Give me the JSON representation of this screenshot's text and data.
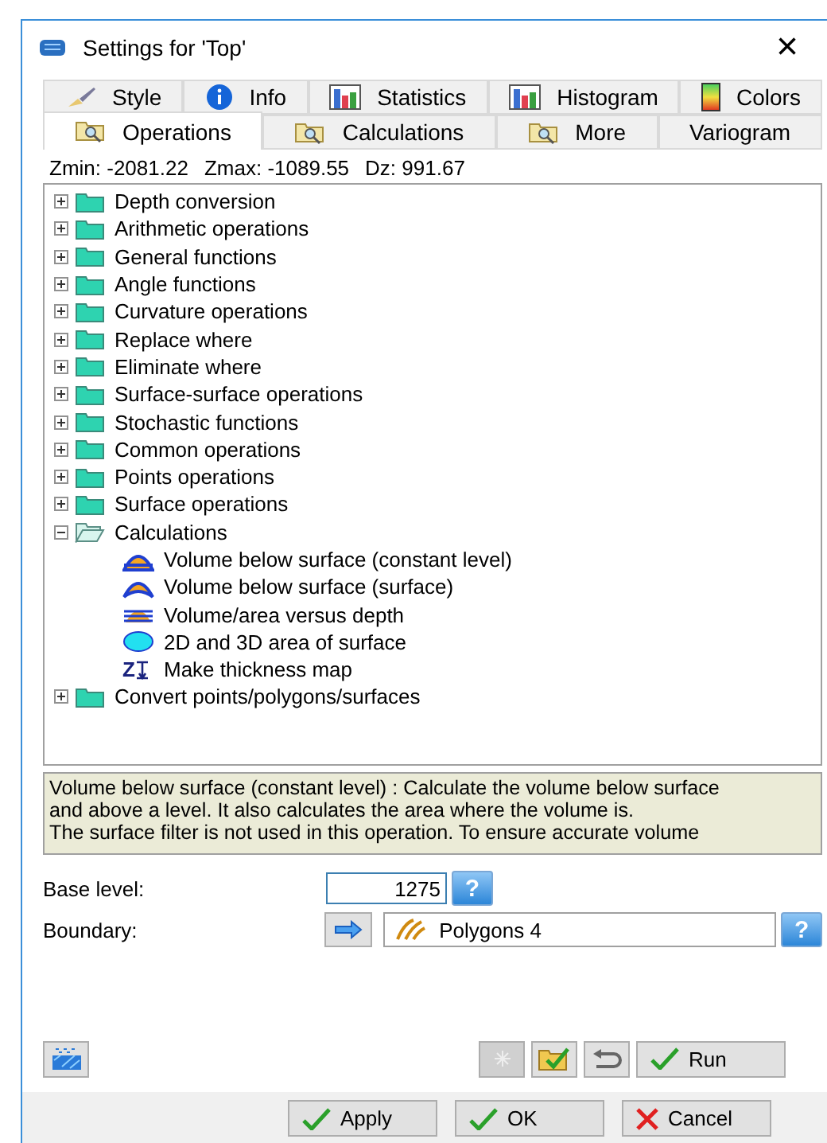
{
  "window": {
    "title": "Settings for 'Top'",
    "close": "×"
  },
  "tab_rows": [
    [
      {
        "label": "Style",
        "kind": "brush",
        "selected": false
      },
      {
        "label": "Info",
        "kind": "info",
        "selected": false
      },
      {
        "label": "Statistics",
        "kind": "bars",
        "selected": false
      },
      {
        "label": "Histogram",
        "kind": "bars",
        "selected": false
      },
      {
        "label": "Colors",
        "kind": "gradient",
        "selected": false
      }
    ],
    [
      {
        "label": "Operations",
        "kind": "folder",
        "selected": true
      },
      {
        "label": "Calculations",
        "kind": "folder",
        "selected": false
      },
      {
        "label": "More",
        "kind": "folder",
        "selected": false
      },
      {
        "label": "Variogram",
        "kind": "plain",
        "selected": false
      }
    ]
  ],
  "stats": [
    {
      "label": "Zmin:",
      "value": "-2081.22"
    },
    {
      "label": "Zmax:",
      "value": "-1089.55"
    },
    {
      "label": "Dz:",
      "value": "991.67"
    }
  ],
  "tree": [
    {
      "label": "Depth conversion",
      "expanded": false
    },
    {
      "label": "Arithmetic operations",
      "expanded": false
    },
    {
      "label": "General functions",
      "expanded": false
    },
    {
      "label": "Angle functions",
      "expanded": false
    },
    {
      "label": "Curvature operations",
      "expanded": false
    },
    {
      "label": "Replace where",
      "expanded": false
    },
    {
      "label": "Eliminate where",
      "expanded": false
    },
    {
      "label": "Surface-surface operations",
      "expanded": false
    },
    {
      "label": "Stochastic functions",
      "expanded": false
    },
    {
      "label": "Common operations",
      "expanded": false
    },
    {
      "label": "Points operations",
      "expanded": false
    },
    {
      "label": "Surface operations",
      "expanded": false
    },
    {
      "label": "Calculations",
      "expanded": true,
      "children": [
        {
          "label": "Volume below surface (constant level)",
          "kind": "volume-level"
        },
        {
          "label": "Volume below surface (surface)",
          "kind": "volume-surface"
        },
        {
          "label": "Volume/area versus depth",
          "kind": "volume-depth"
        },
        {
          "label": "2D and 3D area of surface",
          "kind": "area"
        },
        {
          "label": "Make thickness map",
          "kind": "thickness",
          "icon_text": "Z"
        }
      ]
    },
    {
      "label": "Convert points/polygons/surfaces",
      "expanded": false
    }
  ],
  "description": [
    "Volume below surface (constant level) : Calculate the volume below surface",
    "and above a level. It also calculates the area where the volume is.",
    "The surface filter is not used in this operation. To ensure accurate volume"
  ],
  "base_level": {
    "label": "Base level:",
    "value": "1275",
    "help": "?"
  },
  "boundary": {
    "label": "Boundary:",
    "value": "Polygons 4",
    "help": "?"
  },
  "tools": [
    {
      "kind": "star",
      "disabled": true
    },
    {
      "kind": "folder-check",
      "disabled": false
    },
    {
      "kind": "undo",
      "disabled": false
    }
  ],
  "run": "Run",
  "footer": [
    {
      "label": "Apply",
      "kind": "check"
    },
    {
      "label": "OK",
      "kind": "check"
    },
    {
      "label": "Cancel",
      "kind": "cross"
    }
  ]
}
